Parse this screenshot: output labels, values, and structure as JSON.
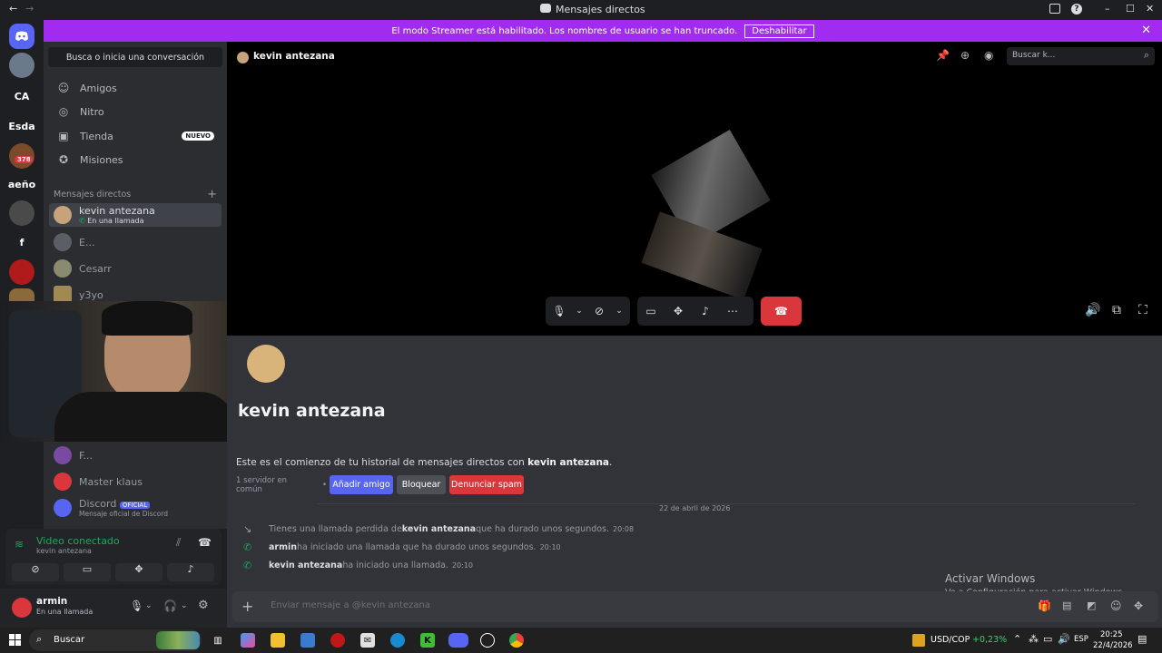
{
  "window": {
    "title": "Mensajes directos",
    "back": "←",
    "forward": "→",
    "min": "–",
    "max": "☐",
    "close": "✕"
  },
  "banner": {
    "text": "El modo Streamer está habilitado. Los nombres de usuario se han truncado.",
    "button": "Deshabilitar",
    "close": "✕"
  },
  "guilds": [
    {
      "label": "CA"
    },
    {
      "label": "Esda"
    },
    {
      "label": "aeño"
    },
    {
      "label": "f"
    },
    {
      "badge": "378"
    }
  ],
  "sidebar": {
    "search": "Busca o inicia una conversación",
    "nav": [
      {
        "label": "Amigos",
        "icon": "friends-icon"
      },
      {
        "label": "Nitro",
        "icon": "nitro-icon"
      },
      {
        "label": "Tienda",
        "icon": "shop-icon",
        "badge": "NUEVO"
      },
      {
        "label": "Misiones",
        "icon": "quests-icon"
      }
    ],
    "dm_header": "Mensajes directos",
    "dms": [
      {
        "name": "kevin antezana",
        "sub": "En una llamada"
      },
      {
        "name": "E..."
      },
      {
        "name": "Cesarr"
      },
      {
        "name": "y3yo"
      },
      {
        "name": "F..."
      },
      {
        "name": "Master klaus"
      },
      {
        "name": "Discord",
        "badge": "OFICIAL",
        "sub": "Mensaje oficial de Discord"
      }
    ]
  },
  "voice": {
    "status": "Video conectado",
    "user": "kevin antezana"
  },
  "user": {
    "name": "armin",
    "status": "En una llamada"
  },
  "dm": {
    "header_name": "kevin antezana",
    "search_placeholder": "Buscar k...",
    "profile_name": "kevin antezana",
    "intro_prefix": "Este es el comienzo de tu historial de mensajes directos con ",
    "intro_name": "kevin antezana",
    "servers_common": "1 servidor en común",
    "add_friend": "Añadir amigo",
    "block": "Bloquear",
    "report": "Denunciar spam",
    "date": "22 de abril de 2026",
    "messages": [
      {
        "pre": "Tienes una llamada perdida de ",
        "name": "kevin antezana",
        "post": " que ha durado unos segundos.",
        "time": "20:08"
      },
      {
        "pre": "",
        "name": "armin",
        "post": " ha iniciado una llamada que ha durado unos segundos.",
        "time": "20:10"
      },
      {
        "pre": "",
        "name": "kevin antezana",
        "post": " ha iniciado una llamada.",
        "time": "20:10"
      }
    ],
    "composer_placeholder": "Enviar mensaje a @kevin antezana"
  },
  "watermark": {
    "line1": "Activar Windows",
    "line2": "Ve a Configuración para activar Windows."
  },
  "taskbar": {
    "search": "Buscar",
    "ticker": "USD/COP",
    "change": "+0,23%",
    "lang": "ESP",
    "time": "20:25",
    "date": "22/4/2026"
  },
  "colors": {
    "banner": "#a12cf0",
    "blurple": "#5865f2",
    "red": "#da373c",
    "green": "#23a55a"
  }
}
